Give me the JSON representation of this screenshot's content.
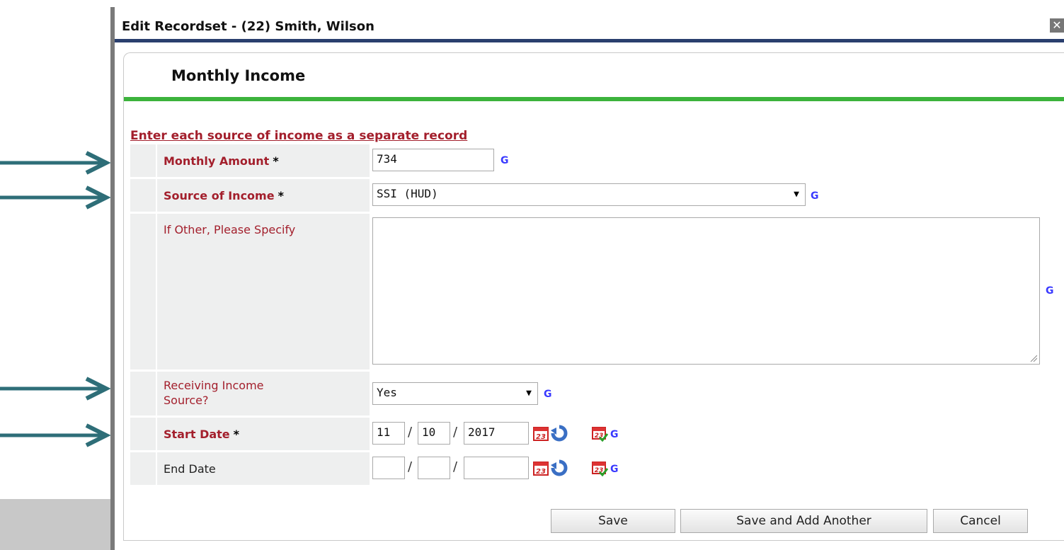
{
  "dialog": {
    "title": "Edit Recordset - (22) Smith, Wilson",
    "close_icon": "close-icon"
  },
  "panel": {
    "title": "Monthly Income",
    "accent_color": "#3cb33c",
    "instruction": "Enter each source of income as a separate record"
  },
  "fields": {
    "monthly_amount": {
      "label": "Monthly Amount",
      "required_mark": "*",
      "value": "734",
      "g": "G"
    },
    "source_of_income": {
      "label": "Source of Income",
      "required_mark": "*",
      "value": "SSI (HUD)",
      "g": "G"
    },
    "if_other": {
      "label": "If Other, Please Specify",
      "value": "",
      "g": "G"
    },
    "receiving_income": {
      "label_line1": "Receiving Income",
      "label_line2": "Source?",
      "value": "Yes",
      "g": "G"
    },
    "start_date": {
      "label": "Start Date",
      "required_mark": "*",
      "month": "11",
      "day": "10",
      "year": "2017",
      "sep": "/",
      "g": "G"
    },
    "end_date": {
      "label": "End Date",
      "month": "",
      "day": "",
      "year": "",
      "sep": "/",
      "g": "G"
    }
  },
  "buttons": {
    "save": "Save",
    "save_add": "Save and Add Another",
    "cancel": "Cancel"
  },
  "colors": {
    "label_red": "#a31f2c",
    "arrow": "#2e6e78",
    "title_bar_border": "#2a3f6e"
  },
  "icons": [
    "calendar-icon",
    "refresh-icon",
    "calendar-check-icon",
    "close-icon",
    "arrow-right-icon"
  ]
}
